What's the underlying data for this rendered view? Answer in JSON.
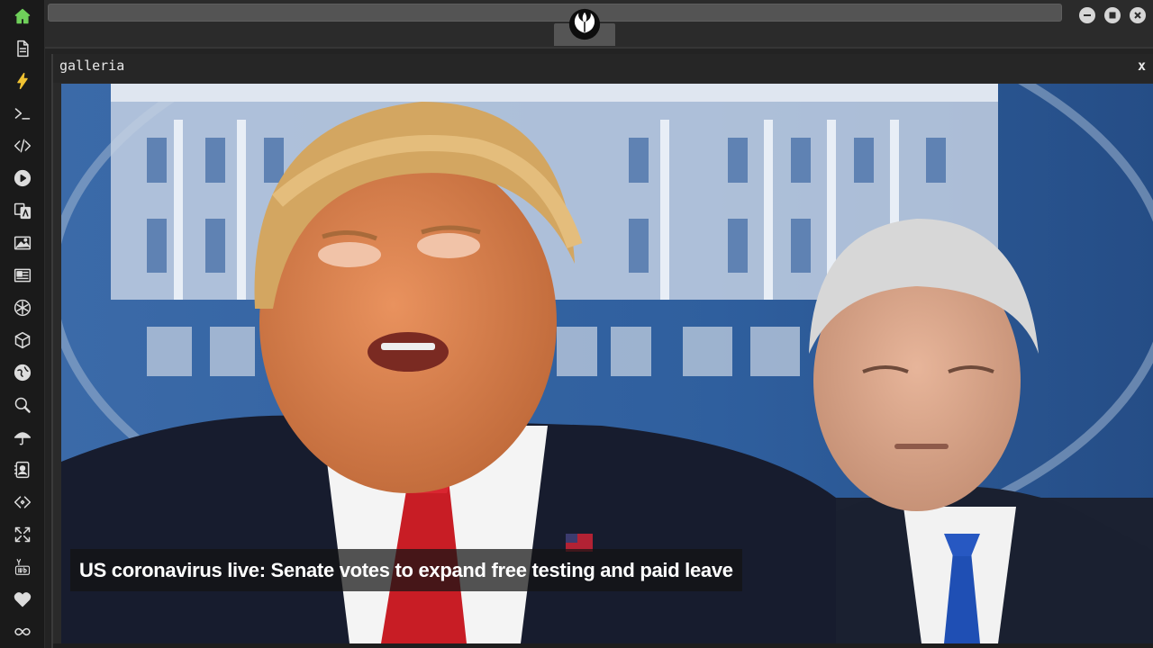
{
  "sidebar": {
    "items": [
      {
        "icon": "home-icon",
        "active": true
      },
      {
        "icon": "document-icon"
      },
      {
        "icon": "lightning-icon"
      },
      {
        "icon": "terminal-icon"
      },
      {
        "icon": "code-icon"
      },
      {
        "icon": "play-icon"
      },
      {
        "icon": "translate-icon"
      },
      {
        "icon": "image-icon"
      },
      {
        "icon": "news-icon"
      },
      {
        "icon": "aperture-icon"
      },
      {
        "icon": "cube-icon"
      },
      {
        "icon": "globe-icon"
      },
      {
        "icon": "search-icon"
      },
      {
        "icon": "umbrella-icon"
      },
      {
        "icon": "contacts-icon"
      },
      {
        "icon": "diamond-code-icon"
      },
      {
        "icon": "expand-icon"
      },
      {
        "icon": "youtube-icon"
      },
      {
        "icon": "heart-icon"
      },
      {
        "icon": "infinity-icon"
      }
    ]
  },
  "topbar": {
    "logo_icon": "rebel-alliance-icon",
    "window_controls": [
      "minimize-icon",
      "maximize-icon",
      "close-icon"
    ]
  },
  "gallery": {
    "title": "galleria",
    "close_label": "x",
    "caption": "US coronavirus live: Senate votes to expand free testing and paid leave"
  },
  "colors": {
    "accent_green": "#6fcf5a",
    "sidebar_bg": "#1a1a1a",
    "window_bg": "#262626",
    "caption_bg": "rgba(20,20,20,0.72)"
  }
}
